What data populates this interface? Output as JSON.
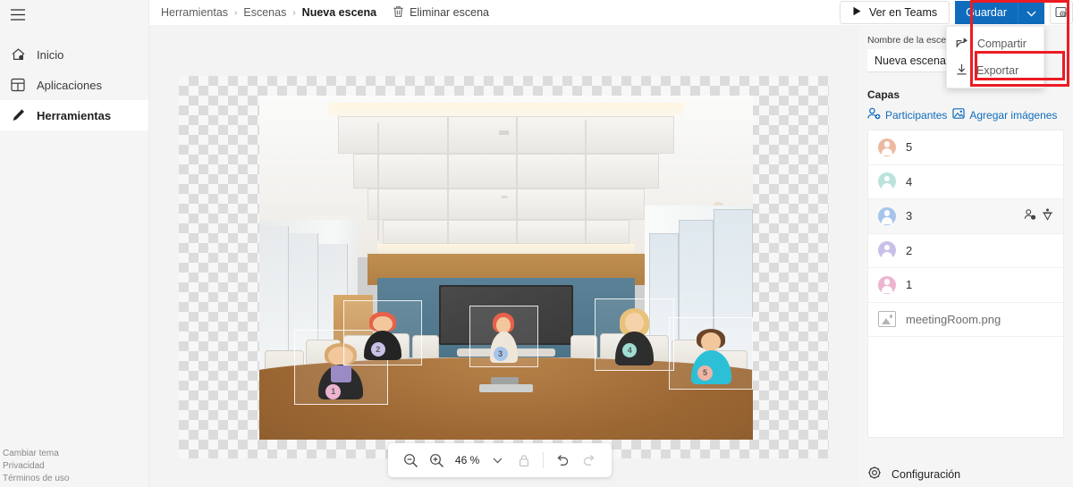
{
  "sidebar": {
    "menu_icon": "hamburger-icon",
    "items": [
      {
        "label": "Inicio",
        "icon": "home-icon",
        "active": false
      },
      {
        "label": "Aplicaciones",
        "icon": "apps-grid-icon",
        "active": false
      },
      {
        "label": "Herramientas",
        "icon": "pencil-icon",
        "active": true
      }
    ],
    "footer_links": [
      "Cambiar tema",
      "Privacidad",
      "Términos de uso"
    ]
  },
  "topbar": {
    "breadcrumb": [
      {
        "label": "Herramientas",
        "current": false
      },
      {
        "label": "Escenas",
        "current": false
      },
      {
        "label": "Nueva escena",
        "current": true
      }
    ],
    "separator": "›",
    "delete_scene": {
      "label": "Eliminar escena",
      "icon": "trash-icon"
    }
  },
  "actions": {
    "teams_button": {
      "label": "Ver en Teams",
      "icon": "play-icon"
    },
    "save_button": {
      "label": "Guardar",
      "caret_icon": "chevron-down-icon",
      "color": "#0f6cbd"
    },
    "lock_corner_icon": "lock-screen-icon",
    "menu": {
      "items": [
        {
          "label": "Compartir",
          "icon": "share-icon",
          "highlighted": false
        },
        {
          "label": "Exportar",
          "icon": "download-icon",
          "highlighted": true
        }
      ],
      "highlight_color": "#ec1c24"
    }
  },
  "right_panel": {
    "scene_name_label": "Nombre de la escena*",
    "scene_name_value": "Nueva escena",
    "layers_title": "Capas",
    "layer_actions": [
      {
        "label": "Participantes",
        "icon": "add-person-icon"
      },
      {
        "label": "Agregar imágenes",
        "icon": "add-image-icon"
      }
    ],
    "link_color": "#0f6cbd",
    "layers": [
      {
        "name": "5",
        "type": "participant",
        "color": "#eeb9a0",
        "selected": false,
        "icons": []
      },
      {
        "name": "4",
        "type": "participant",
        "color": "#b9e3dc",
        "selected": false,
        "icons": []
      },
      {
        "name": "3",
        "type": "participant",
        "color": "#a7c4ec",
        "selected": true,
        "icons": [
          "assign-person-icon",
          "delete-layer-icon"
        ]
      },
      {
        "name": "2",
        "type": "participant",
        "color": "#c9c0e8",
        "selected": false,
        "icons": []
      },
      {
        "name": "1",
        "type": "participant",
        "color": "#edb4d0",
        "selected": false,
        "icons": []
      },
      {
        "name": "meetingRoom.png",
        "type": "image",
        "icon": "image-file-icon",
        "selected": false,
        "icons": []
      }
    ],
    "config": {
      "label": "Configuración",
      "icon": "gear-icon"
    }
  },
  "canvas": {
    "image_name": "meetingRoom.png",
    "participants": [
      {
        "number": "1",
        "badge_color": "#edb4d0"
      },
      {
        "number": "2",
        "badge_color": "#c9c0e8"
      },
      {
        "number": "3",
        "badge_color": "#a7c4ec"
      },
      {
        "number": "4",
        "badge_color": "#b9e3dc"
      },
      {
        "number": "5",
        "badge_color": "#eeb9a0"
      }
    ]
  },
  "zoom_toolbar": {
    "zoom_out_icon": "zoom-out-icon",
    "zoom_in_icon": "zoom-in-icon",
    "zoom_value": "46 %",
    "dropdown_icon": "chevron-down-icon",
    "lock_icon": "lock-icon",
    "undo_icon": "undo-icon",
    "redo_icon": "redo-icon"
  }
}
